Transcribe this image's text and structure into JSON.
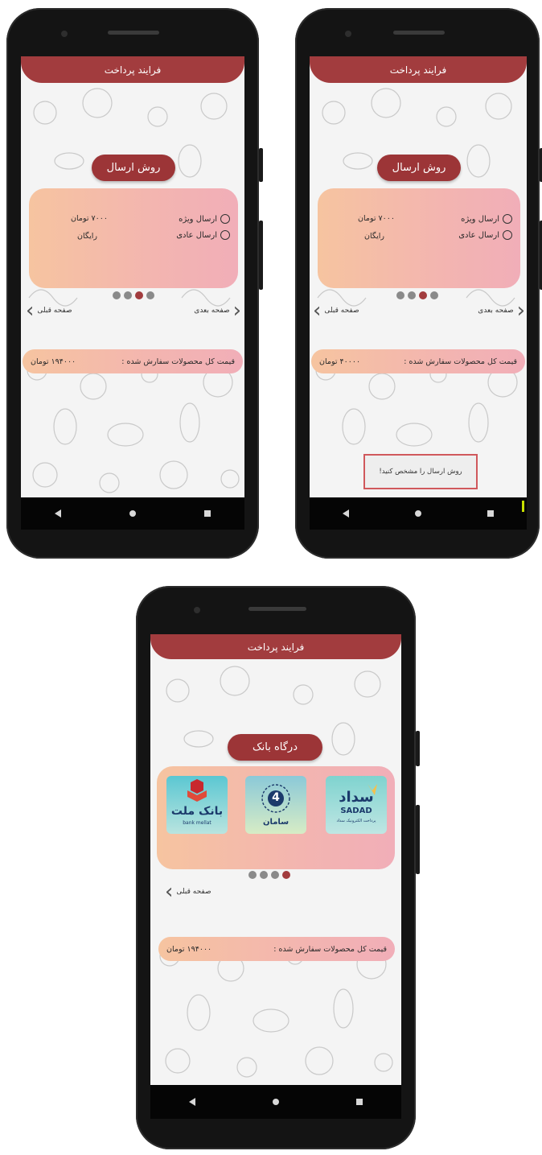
{
  "screen_header_title": "فرایند پرداخت",
  "phone_left": {
    "section_pill": "روش ارسال",
    "options": [
      {
        "label": "ارسال ویژه",
        "price": "۷۰۰۰ تومان"
      },
      {
        "label": "ارسال عادی",
        "price": "رایگان"
      }
    ],
    "nav_next": "صفحه بعدی",
    "nav_prev": "صفحه قبلی",
    "total_label": "قیمت کل محصولات سفارش شده :",
    "total_value": "۱۹۴۰۰۰ تومان"
  },
  "phone_right": {
    "section_pill": "روش ارسال",
    "options": [
      {
        "label": "ارسال ویژه",
        "price": "۷۰۰۰ تومان"
      },
      {
        "label": "ارسال عادی",
        "price": "رایگان"
      }
    ],
    "nav_next": "صفحه بعدی",
    "nav_prev": "صفحه قبلی",
    "total_label": "قیمت کل محصولات سفارش شده :",
    "total_value": "۴۰۰۰۰ تومان",
    "toast": "روش ارسال را مشخص کنید!"
  },
  "phone_bottom": {
    "section_pill": "درگاه بانک",
    "banks": [
      {
        "name": "سداد",
        "sub": "SADAD",
        "caption": "پرداخت الکترونیک سداد",
        "color": "#1b3a6b"
      },
      {
        "name": "سامان",
        "sub": "4",
        "caption": "",
        "color": "#1b3a6b"
      },
      {
        "name": "بانک ملت",
        "sub": "bank mellat",
        "caption": "",
        "color": "#b0262c"
      }
    ],
    "nav_prev": "صفحه قبلی",
    "total_label": "قیمت کل محصولات سفارش شده :",
    "total_value": "۱۹۴۰۰۰ تومان"
  },
  "colors": {
    "brand": "#a23c3e",
    "card_start": "#f6c4a0",
    "card_end": "#f1aeb8"
  }
}
